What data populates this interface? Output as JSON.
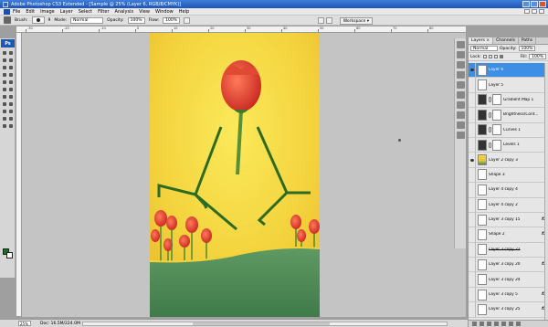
{
  "titlebar": {
    "title": "Adobe Photoshop CS3 Extended - [Sample @ 25% (Layer 6, RGB/8/CMYK)]"
  },
  "menu": [
    "File",
    "Edit",
    "Image",
    "Layer",
    "Select",
    "Filter",
    "Analysis",
    "View",
    "Window",
    "Help"
  ],
  "options": {
    "brush_label": "Brush:",
    "brush_size": "9",
    "mode_label": "Mode:",
    "mode_value": "Normal",
    "opacity_label": "Opacity:",
    "opacity_value": "100%",
    "flow_label": "Flow:",
    "flow_value": "100%",
    "workspace": "Workspace ▾"
  },
  "ruler_labels": [
    "-30",
    "-20",
    "-10",
    "0",
    "10",
    "20",
    "30",
    "40",
    "50",
    "60",
    "70",
    "80"
  ],
  "status": {
    "zoom": "25%",
    "doc": "Doc: 16.5M/224.0M"
  },
  "layers_panel": {
    "tabs": [
      "Layers ×",
      "Channels",
      "Paths"
    ],
    "blend_mode": "Normal",
    "opacity_label": "Opacity:",
    "opacity_value": "100%",
    "lock_label": "Lock:",
    "fill_label": "Fill:",
    "fill_value": "100%",
    "layers": [
      {
        "name": "Layer 6",
        "thumb": "plain",
        "selected": true,
        "eye": true,
        "mask": false,
        "fx": false
      },
      {
        "name": "Layer 5",
        "thumb": "plain",
        "selected": false,
        "eye": false,
        "mask": false,
        "fx": false
      },
      {
        "name": "Gradient Map 1",
        "thumb": "adj",
        "selected": false,
        "eye": false,
        "mask": true,
        "fx": false
      },
      {
        "name": "Brightness/Cont...",
        "thumb": "adj",
        "selected": false,
        "eye": false,
        "mask": true,
        "fx": false
      },
      {
        "name": "Curves 1",
        "thumb": "adj",
        "selected": false,
        "eye": false,
        "mask": true,
        "fx": false
      },
      {
        "name": "Levels 1",
        "thumb": "adj",
        "selected": false,
        "eye": false,
        "mask": true,
        "fx": false
      },
      {
        "name": "Layer 2 copy 3",
        "thumb": "photo",
        "selected": false,
        "eye": true,
        "mask": false,
        "fx": false
      },
      {
        "name": "Shape 3",
        "thumb": "shape",
        "selected": false,
        "eye": false,
        "mask": false,
        "fx": false
      },
      {
        "name": "Layer 4 copy 4",
        "thumb": "plain",
        "selected": false,
        "eye": false,
        "mask": false,
        "fx": false
      },
      {
        "name": "Layer 4 copy 2",
        "thumb": "plain",
        "selected": false,
        "eye": false,
        "mask": false,
        "fx": false
      },
      {
        "name": "Layer 3 copy 15",
        "thumb": "plain",
        "selected": false,
        "eye": false,
        "mask": false,
        "fx": true
      },
      {
        "name": "Shape 2",
        "thumb": "shape",
        "selected": false,
        "eye": false,
        "mask": false,
        "fx": true
      },
      {
        "name": "Layer 3 copy 22",
        "thumb": "plain",
        "selected": false,
        "eye": false,
        "mask": false,
        "fx": false,
        "strike": true
      },
      {
        "name": "Layer 3 copy 20",
        "thumb": "plain",
        "selected": false,
        "eye": false,
        "mask": false,
        "fx": true
      },
      {
        "name": "Layer 3 copy 24",
        "thumb": "plain",
        "selected": false,
        "eye": false,
        "mask": false,
        "fx": false
      },
      {
        "name": "Layer 3 copy 5",
        "thumb": "plain",
        "selected": false,
        "eye": false,
        "mask": false,
        "fx": true
      },
      {
        "name": "Layer 3 copy 25",
        "thumb": "plain",
        "selected": false,
        "eye": false,
        "mask": false,
        "fx": true
      }
    ]
  },
  "colors": {
    "foreground": "#1e6b2a",
    "background": "#ffffff",
    "selected_layer": "#3d8ee5"
  }
}
